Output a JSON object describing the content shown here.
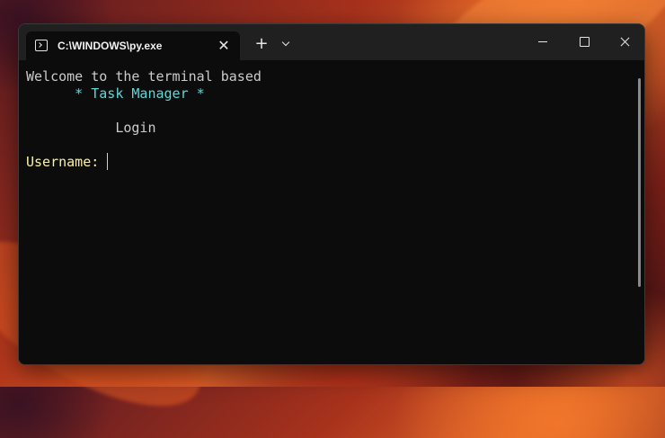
{
  "window": {
    "tab_title": "C:\\WINDOWS\\py.exe",
    "tab_icon": "terminal-icon",
    "close_tab_glyph": "✕",
    "new_tab_glyph": "+",
    "controls": [
      "minimize-icon",
      "maximize-icon",
      "close-icon"
    ]
  },
  "terminal": {
    "line1": "Welcome to the terminal based",
    "line2": "      * Task Manager *",
    "line3": "           Login",
    "prompt": "Username: ",
    "colors": {
      "background": "#0c0c0c",
      "text": "#cccccc",
      "title": "#61d6d6",
      "prompt": "#f9f1a5"
    }
  }
}
